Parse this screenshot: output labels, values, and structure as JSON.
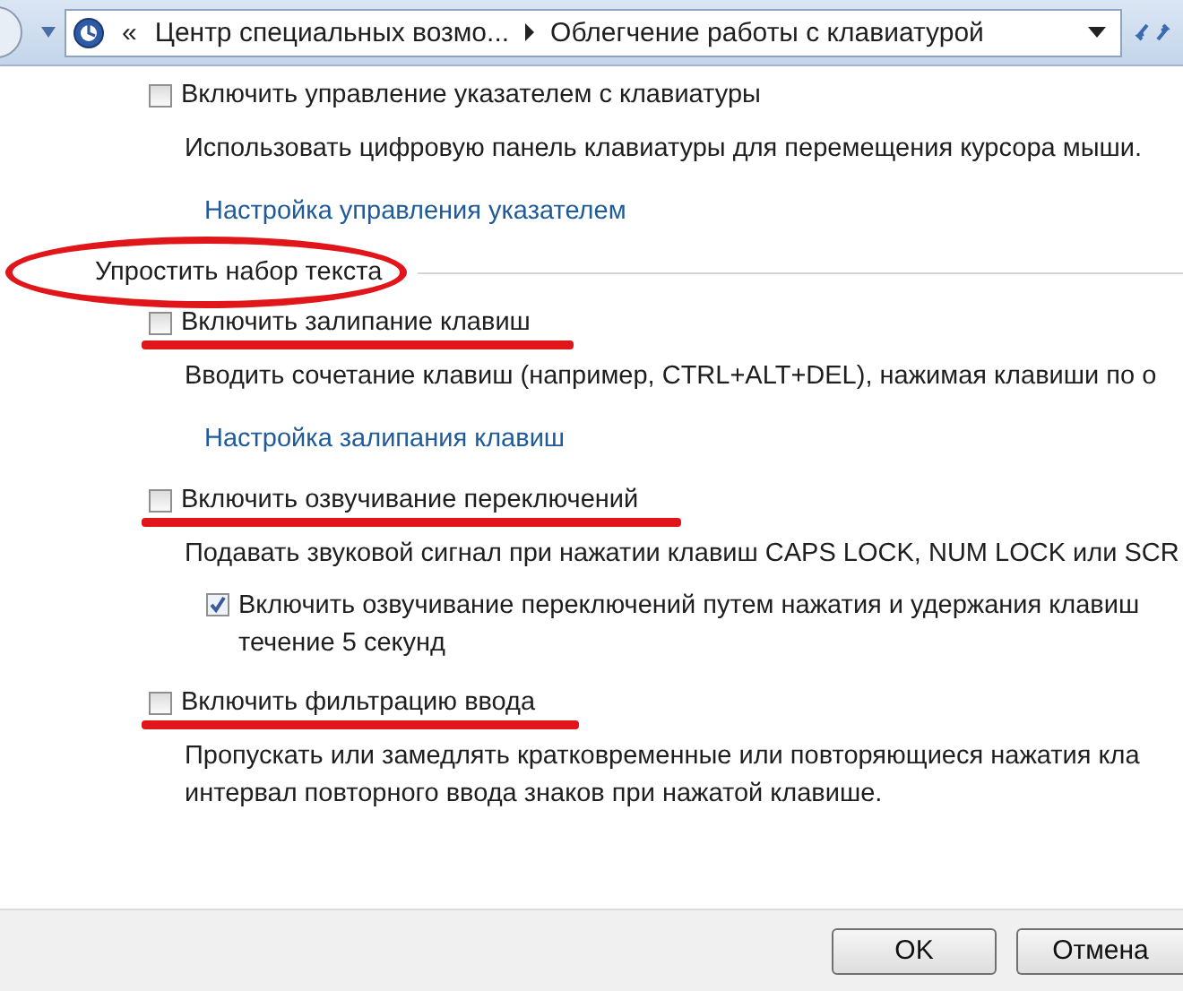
{
  "address_bar": {
    "overflow": "«",
    "crumbs": [
      {
        "label": "Центр специальных возмо..."
      },
      {
        "label": "Облегчение работы с клавиатурой"
      }
    ]
  },
  "blocks": [
    {
      "kind": "option",
      "label": "Включить управление указателем с клавиатуры",
      "checked": false,
      "underlined": false,
      "description": [
        "Использовать цифровую панель клавиатуры для перемещения курсора мыши."
      ],
      "link": "Настройка управления указателем"
    },
    {
      "kind": "heading",
      "label": "Упростить набор текста",
      "circled": true
    },
    {
      "kind": "option",
      "label": "Включить залипание клавиш",
      "checked": false,
      "underlined": true,
      "description": [
        "Вводить сочетание клавиш (например, CTRL+ALT+DEL), нажимая клавиши по о"
      ],
      "link": "Настройка залипания клавиш"
    },
    {
      "kind": "option",
      "label": "Включить озвучивание переключений",
      "checked": false,
      "underlined": true,
      "description": [
        "Подавать звуковой сигнал при нажатии клавиш CAPS LOCK, NUM LOCK или SCR"
      ],
      "suboptions": [
        {
          "lines": [
            "Включить озвучивание переключений путем нажатия и удержания клавиш",
            "течение 5 секунд"
          ],
          "checked": true
        }
      ]
    },
    {
      "kind": "option",
      "label": "Включить фильтрацию ввода",
      "checked": false,
      "underlined": true,
      "description": [
        "Пропускать или замедлять кратковременные или повторяющиеся нажатия кла",
        "интервал повторного ввода знаков при нажатой клавише."
      ]
    }
  ],
  "buttons": [
    {
      "label": "OK"
    },
    {
      "label": "Отмена"
    }
  ]
}
